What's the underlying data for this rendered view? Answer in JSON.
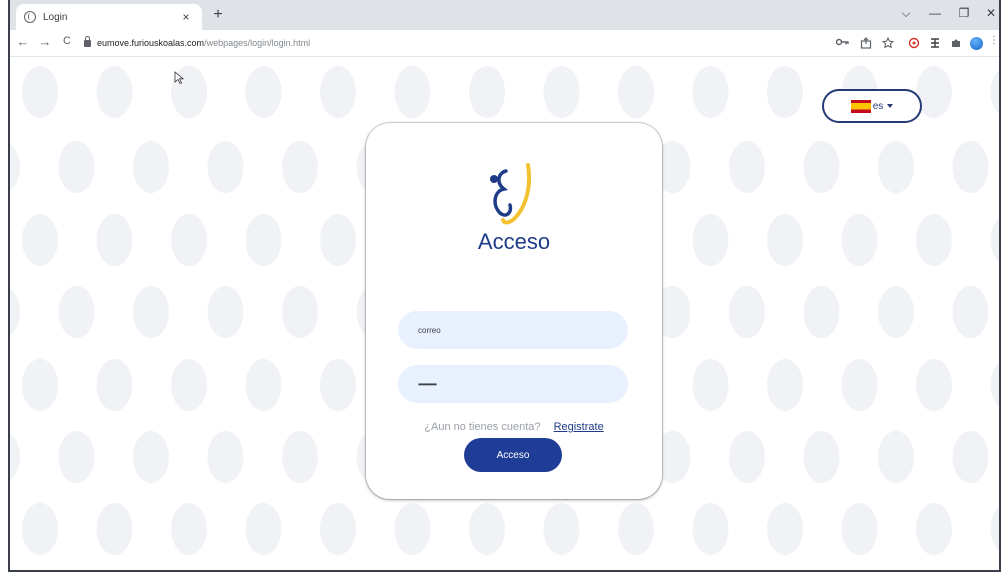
{
  "browser": {
    "tab_title": "Login",
    "tab_close": "×",
    "new_tab": "+",
    "url_host": "eumove.furiouskoalas.com",
    "url_path": "/webpages/login/login.html",
    "nav": {
      "back": "←",
      "forward": "→",
      "reload": "C"
    },
    "window": {
      "minimize_chev": "⌵",
      "minimize": "—",
      "restore": "❐",
      "close": "✕"
    },
    "toolbar_icons": [
      "key-icon",
      "share-icon",
      "star-icon",
      "extension-a-icon",
      "extension-b-icon",
      "puzzle-icon",
      "profile-icon"
    ]
  },
  "language": {
    "code": "es"
  },
  "login": {
    "title": "Acceso",
    "email_value": "correo",
    "password_value": "••••••••••",
    "signup_question": "¿Aun no tienes cuenta?",
    "signup_link": "Registrate",
    "submit_label": "Acceso"
  },
  "colors": {
    "primary": "#1f3c96",
    "field_bg": "#e9f1ff",
    "dot_bg": "#f0f2f6",
    "logo_yellow": "#f2c230",
    "logo_blue": "#1f3c88"
  }
}
